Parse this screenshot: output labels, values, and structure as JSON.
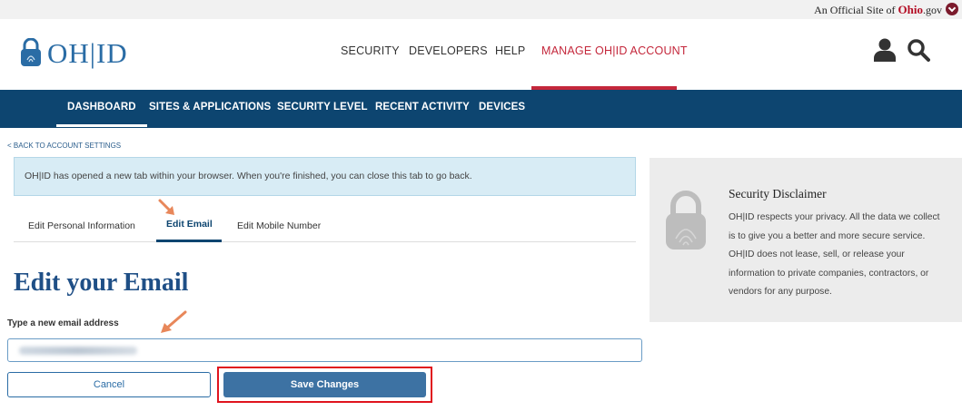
{
  "official_bar": {
    "prefix": "An Official Site of ",
    "ohio": "Ohio",
    "suffix": ".gov"
  },
  "header": {
    "logo_text": "OH|ID",
    "nav": [
      {
        "label": "SECURITY"
      },
      {
        "label": "DEVELOPERS"
      },
      {
        "label": "HELP"
      },
      {
        "label": "MANAGE OH|ID ACCOUNT",
        "active": true
      }
    ],
    "icons": [
      "user-icon",
      "search-icon"
    ]
  },
  "subnav": [
    {
      "label": "DASHBOARD",
      "active": true
    },
    {
      "label": "SITES & APPLICATIONS"
    },
    {
      "label": "SECURITY LEVEL"
    },
    {
      "label": "RECENT ACTIVITY"
    },
    {
      "label": "DEVICES"
    }
  ],
  "back_link": "< BACK TO ACCOUNT SETTINGS",
  "info_alert": "OH|ID has opened a new tab within your browser. When you're finished, you can close this tab to go back.",
  "tabs": [
    {
      "label": "Edit Personal Information"
    },
    {
      "label": "Edit Email",
      "active": true
    },
    {
      "label": "Edit Mobile Number"
    }
  ],
  "form": {
    "title": "Edit your Email",
    "email_label": "Type a new email address",
    "cancel_label": "Cancel",
    "save_label": "Save Changes"
  },
  "disclaimer": {
    "title": "Security Disclaimer",
    "body": "OH|ID respects your privacy. All the data we collect is to give you a better and more secure service. OH|ID does not lease, sell, or release your information to private companies, contractors, or vendors for any purpose."
  },
  "colors": {
    "brand_blue": "#2a6ca5",
    "nav_dark": "#0d4570",
    "active_red": "#c4273b",
    "highlight_red": "#e0141e",
    "annotation_arrow": "#e8875a"
  }
}
